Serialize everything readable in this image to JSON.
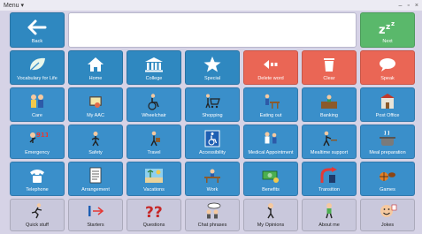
{
  "window": {
    "menu_label": "Menu",
    "menu_arrow": "▾",
    "controls": [
      "–",
      "▫",
      "×"
    ]
  },
  "message_bar": {
    "value": ""
  },
  "row1": {
    "back": "Back",
    "next": "Next"
  },
  "row2": [
    {
      "label": "Vocabulary for Life",
      "icon": "leaf-icon"
    },
    {
      "label": "Home",
      "icon": "house-icon"
    },
    {
      "label": "College",
      "icon": "college-building-icon"
    },
    {
      "label": "Special",
      "icon": "star-icon"
    },
    {
      "label": "Delete word",
      "icon": "delete-word-icon"
    },
    {
      "label": "Clear",
      "icon": "trash-icon"
    },
    {
      "label": "Speak",
      "icon": "speech-bubble-icon"
    }
  ],
  "row3": [
    {
      "label": "Care",
      "icon": "carers-icon"
    },
    {
      "label": "My AAC",
      "icon": "aac-device-icon"
    },
    {
      "label": "Wheelchair",
      "icon": "wheelchair-person-icon"
    },
    {
      "label": "Shopping",
      "icon": "shopping-cart-icon"
    },
    {
      "label": "Eating out",
      "icon": "restaurant-icon"
    },
    {
      "label": "Banking",
      "icon": "bank-icon"
    },
    {
      "label": "Post Office",
      "icon": "post-office-icon"
    }
  ],
  "row4": [
    {
      "label": "Emergency",
      "icon": "emergency-911-icon"
    },
    {
      "label": "Safety",
      "icon": "safety-icon"
    },
    {
      "label": "Travel",
      "icon": "travel-icon"
    },
    {
      "label": "Accessibility",
      "icon": "accessibility-icon"
    },
    {
      "label": "Medical Appointment",
      "icon": "medical-icon"
    },
    {
      "label": "Mealtime support",
      "icon": "mealtime-icon"
    },
    {
      "label": "Meal preparation",
      "icon": "cooking-pot-icon"
    }
  ],
  "row5": [
    {
      "label": "Telephone",
      "icon": "telephone-icon"
    },
    {
      "label": "Arrangement",
      "icon": "arrangement-list-icon"
    },
    {
      "label": "Vacations",
      "icon": "vacation-icon"
    },
    {
      "label": "Work",
      "icon": "work-desk-icon"
    },
    {
      "label": "Benefits",
      "icon": "money-icon"
    },
    {
      "label": "Transition",
      "icon": "transition-icon"
    },
    {
      "label": "Games",
      "icon": "ball-games-icon"
    }
  ],
  "row6": [
    {
      "label": "Quick stuff",
      "icon": "running-person-icon"
    },
    {
      "label": "Starters",
      "icon": "starters-icon"
    },
    {
      "label": "Questions",
      "icon": "question-marks-icon"
    },
    {
      "label": "Chat phrases",
      "icon": "chat-people-icon"
    },
    {
      "label": "My Opinions",
      "icon": "thinking-person-icon"
    },
    {
      "label": "About me",
      "icon": "about-me-person-icon"
    },
    {
      "label": "Jokes",
      "icon": "jokes-face-icon"
    }
  ],
  "colors": {
    "category_blue": "#3a8fca",
    "action_red": "#ea6655",
    "next_green": "#5ab86b",
    "grey_cell": "#c9c8dc",
    "background": "#d6d3e6"
  }
}
